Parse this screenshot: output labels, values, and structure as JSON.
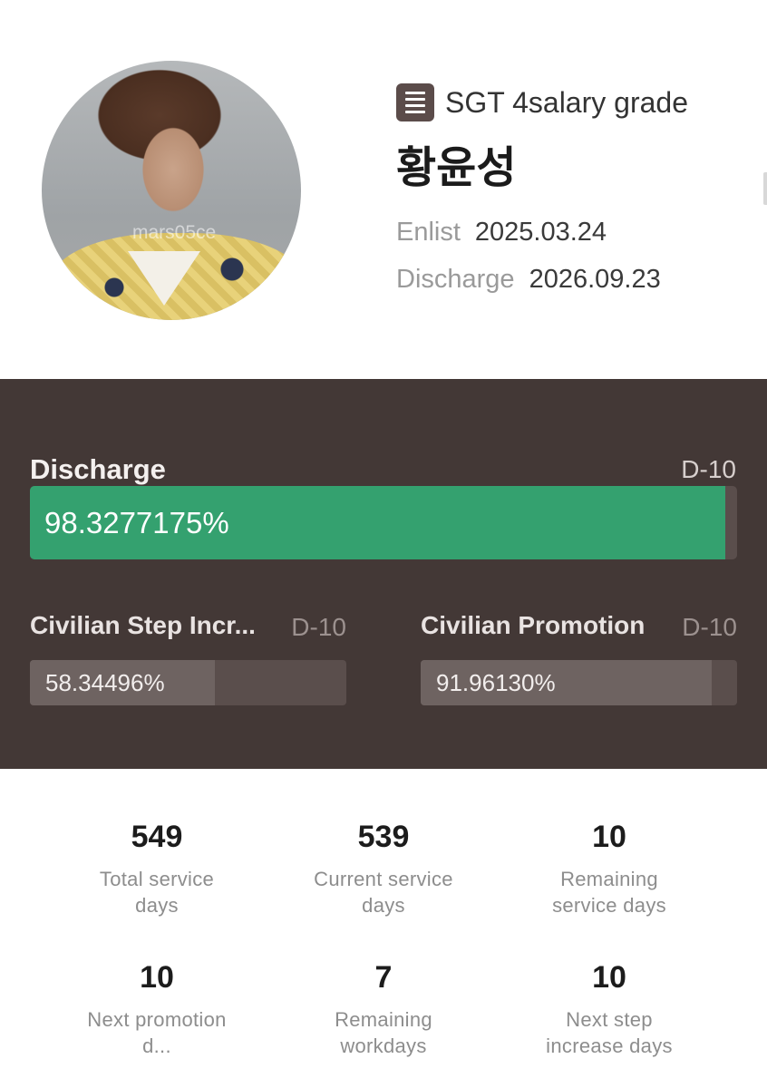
{
  "profile": {
    "watermark": "mars05ce",
    "grade": "SGT 4salary grade",
    "grade_icon": "document-list-icon",
    "name": "황윤성",
    "enlist_label": "Enlist",
    "enlist_date": "2025.03.24",
    "discharge_label": "Discharge",
    "discharge_date": "2026.09.23"
  },
  "discharge_progress": {
    "title": "Discharge",
    "dday": "D-10",
    "percent_text": "98.3277175%",
    "fraction": 0.983277175,
    "color": "#34a16f"
  },
  "step_increase": {
    "title": "Civilian Step Incr...",
    "dday": "D-10",
    "percent_text": "58.34496%",
    "fraction": 0.5834496
  },
  "promotion": {
    "title": "Civilian Promotion",
    "dday": "D-10",
    "percent_text": "91.96130%",
    "fraction": 0.919613
  },
  "stats": [
    {
      "value": "549",
      "label": "Total service days"
    },
    {
      "value": "539",
      "label": "Current service days"
    },
    {
      "value": "10",
      "label": "Remaining service days"
    },
    {
      "value": "10",
      "label": "Next promotion d..."
    },
    {
      "value": "7",
      "label": "Remaining workdays"
    },
    {
      "value": "10",
      "label": "Next step increase days"
    }
  ],
  "colors": {
    "panel_bg": "#433836",
    "bar_track": "#5a4e4c",
    "bar_fill_muted": "#6e6361",
    "accent_green": "#34a16f"
  }
}
